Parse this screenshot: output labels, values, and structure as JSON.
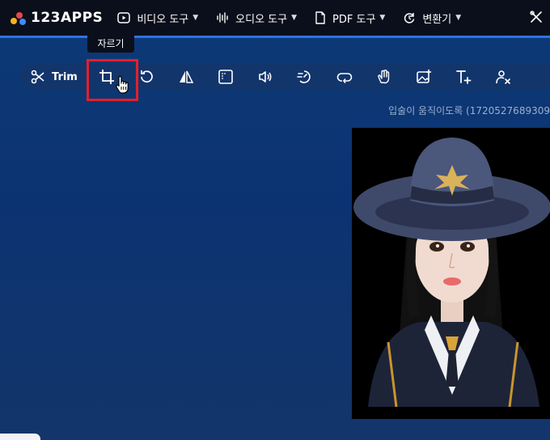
{
  "brand": {
    "name": "123APPS"
  },
  "nav": [
    {
      "label": "비디오 도구",
      "icon": "play-circle-icon"
    },
    {
      "label": "오디오 도구",
      "icon": "audio-wave-icon"
    },
    {
      "label": "PDF 도구",
      "icon": "document-icon"
    },
    {
      "label": "변환기",
      "icon": "convert-icon"
    }
  ],
  "tooltip": {
    "text": "자르기"
  },
  "toolbar": {
    "trim_label": "Trim",
    "tools": [
      "crop-icon",
      "rotate-icon",
      "flip-icon",
      "resize-icon",
      "volume-icon",
      "speed-icon",
      "loop-icon",
      "stabilize-icon",
      "add-image-icon",
      "add-text-icon",
      "remove-logo-icon"
    ]
  },
  "file": {
    "name": "입술이 움직이도록 (1720527689309"
  },
  "colors": {
    "accent": "#2f72e6",
    "highlight": "#e3202a",
    "topbar": "#0b0f1c"
  }
}
